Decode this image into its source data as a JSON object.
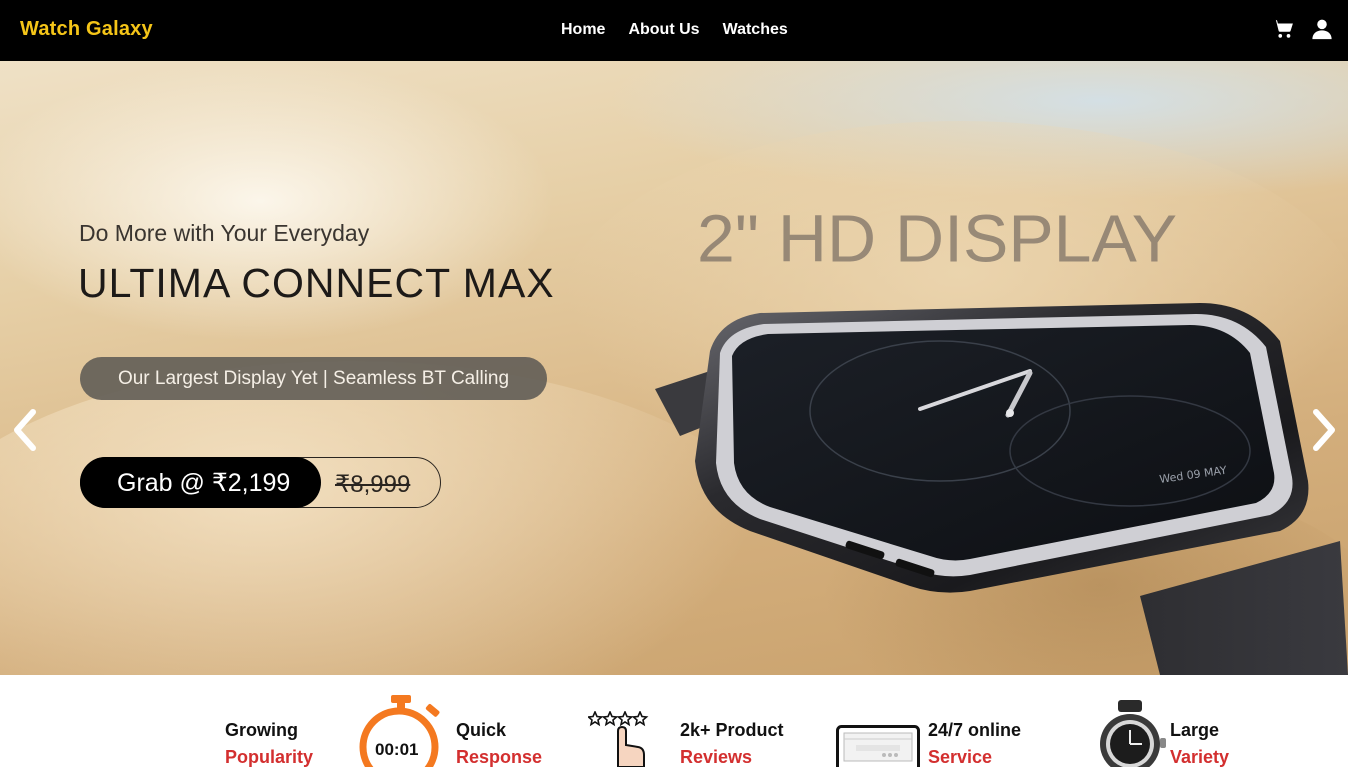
{
  "navbar": {
    "brand": "Watch Galaxy",
    "links": [
      "Home",
      "About Us",
      "Watches"
    ],
    "icons": [
      "cart-icon",
      "user-icon"
    ],
    "brand_color": "#f5c518",
    "background": "#000000"
  },
  "hero": {
    "subtitle": "Do More with Your Everyday",
    "title": "ULTIMA CONNECT MAX",
    "tagline": "Our Largest Display Yet | Seamless BT Calling",
    "price_label": "Grab @ ₹2,199",
    "old_price": "₹8,999",
    "display_text": "2\" HD DISPLAY",
    "watch_time": "Wed 09 MAY",
    "arrows": [
      "chevron-left-icon",
      "chevron-right-icon"
    ]
  },
  "features": [
    {
      "title": "Growing",
      "accent": "Popularity",
      "icon": "trophy-icon"
    },
    {
      "title": "Quick",
      "accent": "Response",
      "icon": "stopwatch-icon",
      "icon_text": "00:01"
    },
    {
      "title": "2k+ Product",
      "accent": "Reviews",
      "icon": "star-review-icon"
    },
    {
      "title": "24/7 online",
      "accent": "Service",
      "icon": "laptop-icon"
    },
    {
      "title": "Large",
      "accent": "Variety",
      "icon": "watch-icon"
    }
  ],
  "accent_color": "#d32f2f"
}
